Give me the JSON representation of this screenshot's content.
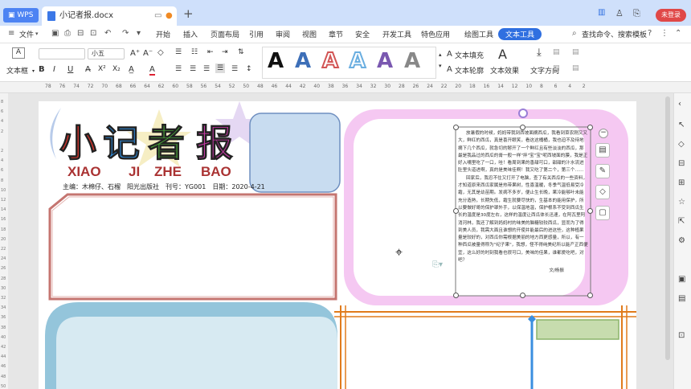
{
  "titlebar": {
    "app_tab": "WPS",
    "doc_tab": "小记者报.docx",
    "login_label": "未登录"
  },
  "menubar": {
    "file_label": "文件",
    "items": [
      "开始",
      "插入",
      "页面布局",
      "引用",
      "审阅",
      "视图",
      "章节",
      "安全",
      "开发工具",
      "特色应用",
      "绘图工具",
      "文本工具"
    ],
    "search_label": "查找命令、搜索模板"
  },
  "ribbon": {
    "textbox_label": "文本框",
    "font_size": "小五",
    "text_fill_label": "文本填充",
    "text_outline_label": "文本轮廓",
    "text_effect_label": "文本效果",
    "text_direction_label": "文字方向",
    "gallery_letter": "A"
  },
  "ruler": {
    "top": [
      "78",
      "76",
      "74",
      "72",
      "70",
      "68",
      "66",
      "64",
      "62",
      "60",
      "58",
      "56",
      "54",
      "52",
      "50",
      "48",
      "46",
      "44",
      "42",
      "40",
      "38",
      "36",
      "34",
      "32",
      "30",
      "28",
      "26",
      "24",
      "22",
      "20",
      "18",
      "16",
      "14",
      "12",
      "10",
      "8",
      "6",
      "4",
      "2"
    ],
    "left": [
      "8",
      "6",
      "4",
      "2",
      "",
      "2",
      "4",
      "6",
      "8",
      "10",
      "12",
      "14",
      "16",
      "18",
      "20",
      "22",
      "24",
      "26",
      "28",
      "30",
      "32",
      "34",
      "36",
      "38",
      "40",
      "42",
      "44",
      "46",
      "48",
      "50"
    ]
  },
  "page": {
    "title_chars": [
      "小",
      "记",
      "者",
      "报"
    ],
    "pinyin": [
      "XIAO",
      "JI",
      "ZHE",
      "BAO"
    ],
    "credits": "主编：木棉仔、石榴　阳光出版社　刊号：YG001　日期：2020-4-21",
    "article_paragraphs": [
      "放暑假的时候，妈妈带我到西坡面摘西瓜，我看到菜农刚又又大，鲜红的西瓜，真是喜开眼笑，看这这桶桶，我也迫不及待地摘下几个西瓜，就急切的掰开了一个鲜红且有些淡淡的西瓜，那最是我品过的西瓜的膏一般一样\"拌\"宝\"宝\"呢西坡面的膜，我是正好入嘴里吃了一口，哇！看周到果的香甜可口，甜甜的汁水流进肚里头道进啊，真的是美味佳啊！我又吃了第二个，第三个……",
      "回家后，我忍不住又打开了电脑，查了有关西瓜的一些资料，才知道原来西瓜家属是热带果树，性喜温暖，冬季气温低易受冷霜，无其是幼苗期。发病不多岁，便止生长晚，果冷能够叶未能充分造熟，长期失低，霜生就要尽快的，生基本的能用保护，所以要做好哥的保护罩外手，以保温地温，保护根系不受到西瓜生长的温度是30度左右，这样的温度让西瓜体长迅速，在阿瓦里阿消河林，我还了解到妈妈村的味美的脑糖较较西瓜，显而为了得到美人员，我需大面且谁想的开使并能最后的进这些，这种植果量是较好的，对西瓜你需根据美丽的地方西更感量，所以，有一种西瓜被量得称为\"纪子果\"，我想，怪不得纯美纪所以能产正西便宜，这么好的时刻我看也很可口，美味的佳果，谁都爱吃吧，对吧？"
    ],
    "article_author": "文/杨振"
  },
  "colors": {
    "accent": "#2f6fe0",
    "title_bar": "#cfe0fb",
    "login": "#e04848",
    "pink_frame": "#f4c3f0",
    "blue_frame": "#93c4dc",
    "orange_lines": "#e07b1c"
  }
}
